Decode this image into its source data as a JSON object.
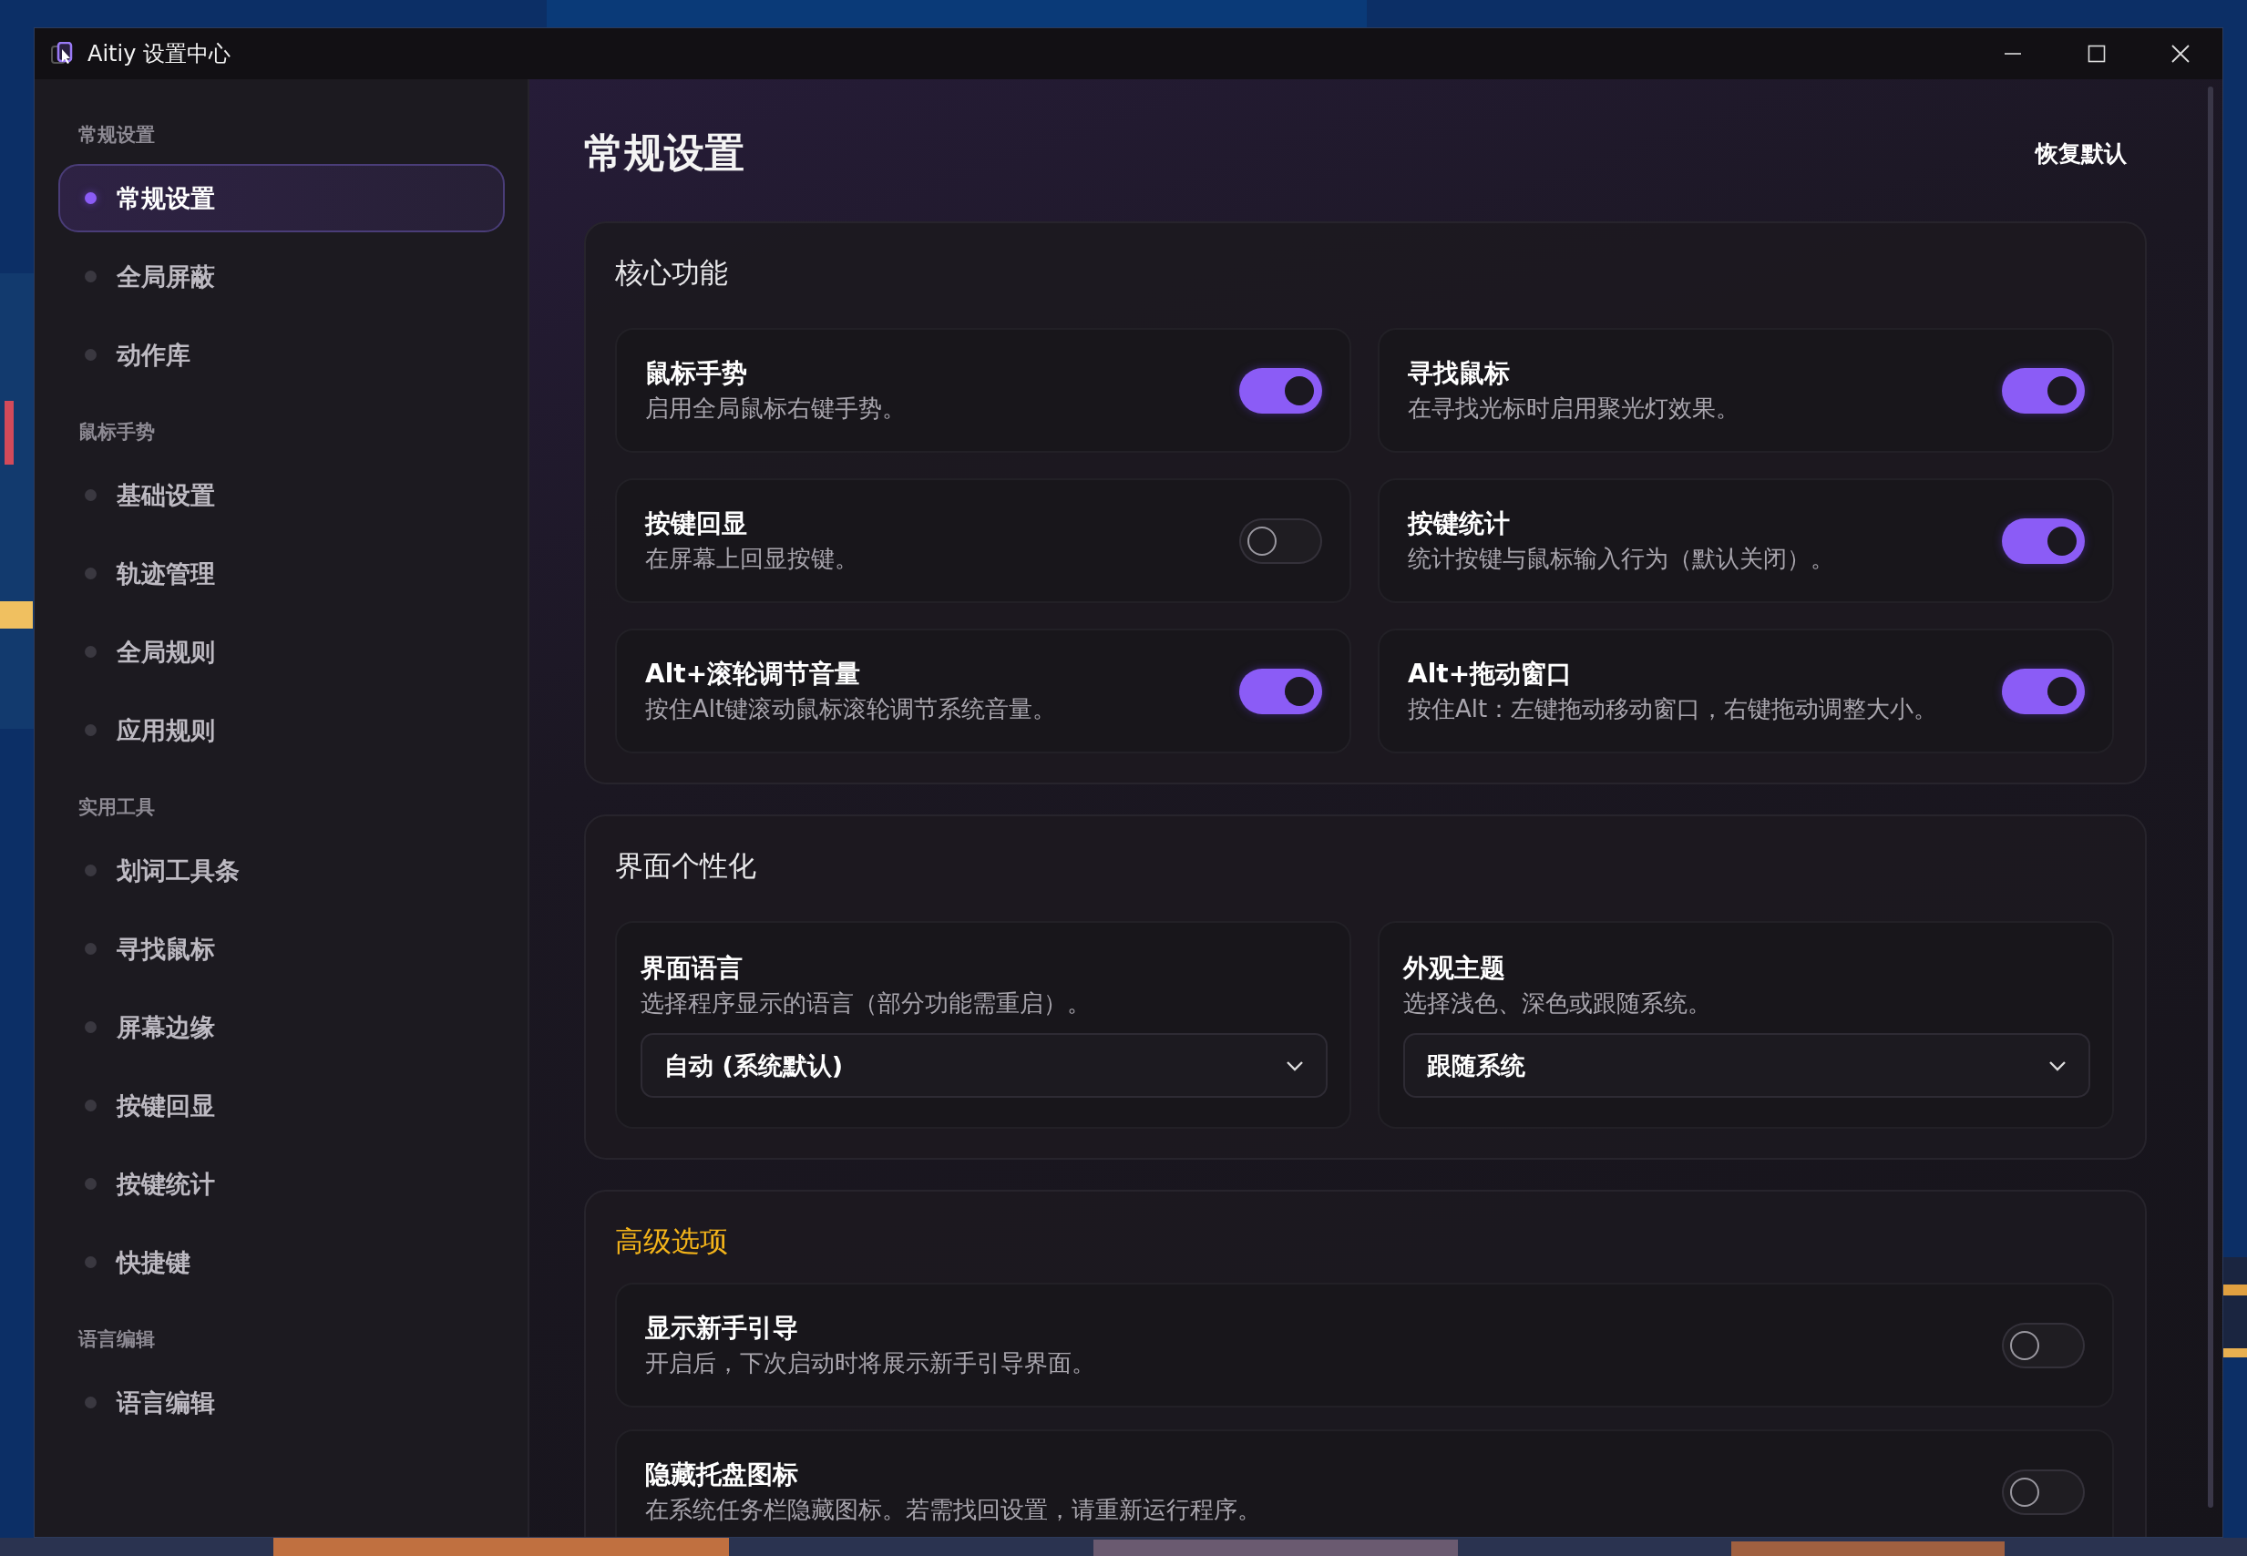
{
  "window": {
    "title": "Aitiy 设置中心"
  },
  "sidebar": {
    "sections": [
      {
        "title": "常规设置",
        "items": [
          {
            "label": "常规设置",
            "selected": true
          },
          {
            "label": "全局屏蔽",
            "selected": false
          },
          {
            "label": "动作库",
            "selected": false
          }
        ]
      },
      {
        "title": "鼠标手势",
        "items": [
          {
            "label": "基础设置",
            "selected": false
          },
          {
            "label": "轨迹管理",
            "selected": false
          },
          {
            "label": "全局规则",
            "selected": false
          },
          {
            "label": "应用规则",
            "selected": false
          }
        ]
      },
      {
        "title": "实用工具",
        "items": [
          {
            "label": "划词工具条",
            "selected": false
          },
          {
            "label": "寻找鼠标",
            "selected": false
          },
          {
            "label": "屏幕边缘",
            "selected": false
          },
          {
            "label": "按键回显",
            "selected": false
          },
          {
            "label": "按键统计",
            "selected": false
          },
          {
            "label": "快捷键",
            "selected": false
          }
        ]
      },
      {
        "title": "语言编辑",
        "items": [
          {
            "label": "语言编辑",
            "selected": false
          }
        ]
      }
    ]
  },
  "page": {
    "title": "常规设置",
    "reset_button": "恢复默认"
  },
  "cards": [
    {
      "title": "核心功能",
      "kind": "grid",
      "highlighted": false,
      "settings": [
        {
          "kind": "toggle",
          "title": "鼠标手势",
          "description": "启用全局鼠标右键手势。",
          "on": true
        },
        {
          "kind": "toggle",
          "title": "寻找鼠标",
          "description": "在寻找光标时启用聚光灯效果。",
          "on": true
        },
        {
          "kind": "toggle",
          "title": "按键回显",
          "description": "在屏幕上回显按键。",
          "on": false
        },
        {
          "kind": "toggle",
          "title": "按键统计",
          "description": "统计按键与鼠标输入行为（默认关闭）。",
          "on": true
        },
        {
          "kind": "toggle",
          "title": "Alt+滚轮调节音量",
          "description": "按住Alt键滚动鼠标滚轮调节系统音量。",
          "on": true
        },
        {
          "kind": "toggle",
          "title": "Alt+拖动窗口",
          "description": "按住Alt：左键拖动移动窗口，右键拖动调整大小。",
          "on": true
        }
      ]
    },
    {
      "title": "界面个性化",
      "kind": "grid",
      "highlighted": false,
      "settings": [
        {
          "kind": "dropdown",
          "title": "界面语言",
          "description": "选择程序显示的语言（部分功能需重启）。",
          "value": "自动 (系统默认)"
        },
        {
          "kind": "dropdown",
          "title": "外观主题",
          "description": "选择浅色、深色或跟随系统。",
          "value": "跟随系统"
        }
      ]
    },
    {
      "title": "高级选项",
      "kind": "list",
      "highlighted": true,
      "settings": [
        {
          "kind": "toggle",
          "title": "显示新手引导",
          "description": "开启后，下次启动时将展示新手引导界面。",
          "on": false
        },
        {
          "kind": "toggle",
          "title": "隐藏托盘图标",
          "description": "在系统任务栏隐藏图标。若需找回设置，请重新运行程序。",
          "on": false
        }
      ]
    }
  ]
}
